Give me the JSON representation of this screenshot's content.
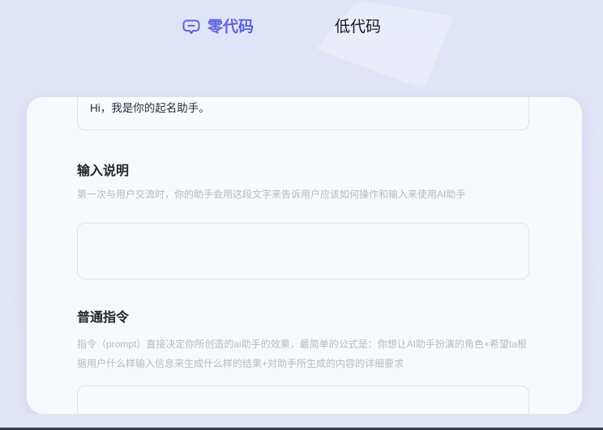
{
  "tabs": {
    "items": [
      {
        "label": "零代码",
        "active": true,
        "icon": "chat-bubble-icon"
      },
      {
        "label": "低代码",
        "active": false
      }
    ]
  },
  "assistant_form": {
    "opening_message": {
      "value": "Hi，我是你的起名助手。"
    },
    "sections": [
      {
        "title": "输入说明",
        "description": "第一次与用户交流时，你的助手会用这段文字来告诉用户应该如何操作和输入来使用AI助手",
        "field_value": ""
      },
      {
        "title": "普通指令",
        "description": "指令（prompt）直接决定你所创造的ai助手的效果，最简单的公式是：你想让AI助手扮演的角色+希望ta根据用户什么样输入信息来生成什么样的结果+对助手所生成的内容的详细要求",
        "field_value": ""
      }
    ]
  },
  "colors": {
    "accent": "#5d62e0",
    "page_bg": "#e0e4f7",
    "card_bg": "#f7f9fc",
    "heading_text": "#20252c",
    "muted_text": "#b5bbc5",
    "field_border": "#dde2e9",
    "bottom_bar": "#363c49"
  }
}
